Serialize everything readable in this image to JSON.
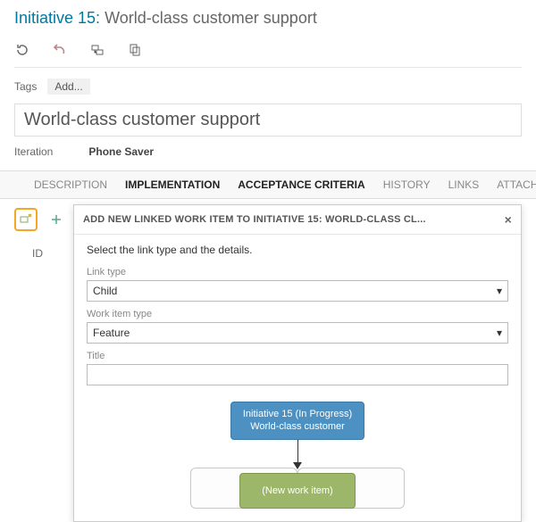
{
  "header": {
    "prefix": "Initiative 15:",
    "title": "World-class customer support"
  },
  "toolbar_icons": {
    "refresh": "refresh-icon",
    "undo": "undo-icon",
    "link": "link-icon",
    "copy": "copy-icon"
  },
  "tags": {
    "label": "Tags",
    "add": "Add..."
  },
  "title_input": "World-class customer support",
  "iteration": {
    "label": "Iteration",
    "value": "Phone Saver"
  },
  "tabs": {
    "description": "DESCRIPTION",
    "implementation": "IMPLEMENTATION",
    "acceptance": "ACCEPTANCE CRITERIA",
    "history": "HISTORY",
    "links": "LINKS",
    "attach": "ATTACH..."
  },
  "impl": {
    "id_label": "ID"
  },
  "dialog": {
    "title": "ADD NEW LINKED WORK ITEM TO INITIATIVE 15: WORLD-CLASS CL...",
    "instruction": "Select the link type and the details.",
    "link_type_label": "Link type",
    "link_type_value": "Child",
    "work_item_type_label": "Work item type",
    "work_item_type_value": "Feature",
    "title_label": "Title",
    "title_value": "",
    "parent_line1": "Initiative 15 (In Progress)",
    "parent_line2": "World-class customer",
    "new_item": "(New work item)"
  }
}
